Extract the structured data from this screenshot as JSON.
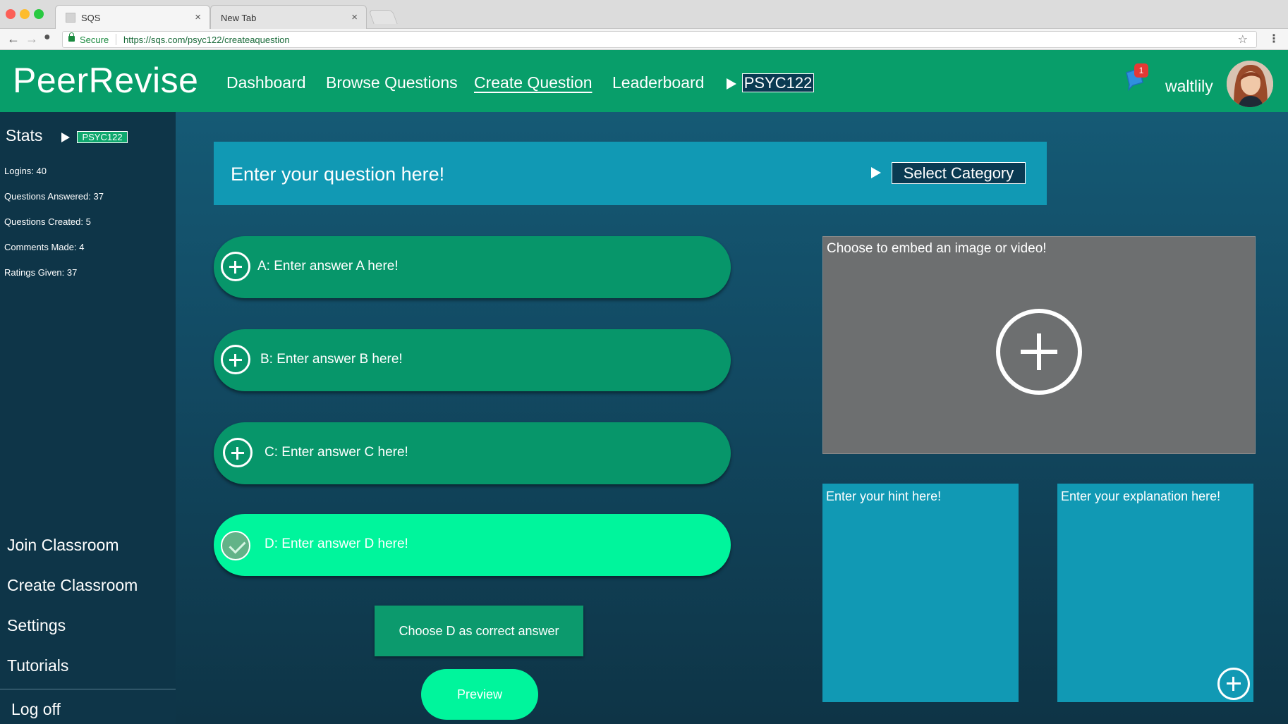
{
  "browser": {
    "tabs": [
      {
        "label": "SQS",
        "close": "×"
      },
      {
        "label": "New Tab",
        "close": "×"
      }
    ],
    "secure_label": "Secure",
    "url": "https://sqs.com/psyc122/createaquestion"
  },
  "header": {
    "logo": "PeerRevise",
    "nav": [
      "Dashboard",
      "Browse Questions",
      "Create Question",
      "Leaderboard"
    ],
    "active_nav": "Create Question",
    "course": "PSYC122",
    "notification_count": "1",
    "username": "waltlily",
    "colors": {
      "header": "#089e6a",
      "badge": "#e53935"
    }
  },
  "sidebar": {
    "stats_title": "Stats",
    "course": "PSYC122",
    "stats": [
      "Logins: 40",
      "Questions Answered: 37",
      "Questions Created: 5",
      "Comments Made: 4",
      "Ratings Given: 37"
    ],
    "links": [
      "Join Classroom",
      "Create Classroom",
      "Settings",
      "Tutorials"
    ],
    "logoff": "Log off"
  },
  "main": {
    "question_placeholder": "Enter your question here!",
    "category_label": "Select Category",
    "answers": [
      {
        "label": "A: Enter answer A here!",
        "correct": false
      },
      {
        "label": "B: Enter answer B here!",
        "correct": false
      },
      {
        "label": "C: Enter answer C here!",
        "correct": false
      },
      {
        "label": "D: Enter answer D here!",
        "correct": true
      }
    ],
    "choose_button": "Choose D as correct answer",
    "preview_button": "Preview",
    "media_label": "Choose to embed an image or video!",
    "hint_label": "Enter your hint here!",
    "explanation_label": "Enter your explanation here!",
    "colors": {
      "answer": "#07966a",
      "correct": "#00f59c",
      "panel": "#1199b4",
      "media": "#6d6f70"
    }
  }
}
